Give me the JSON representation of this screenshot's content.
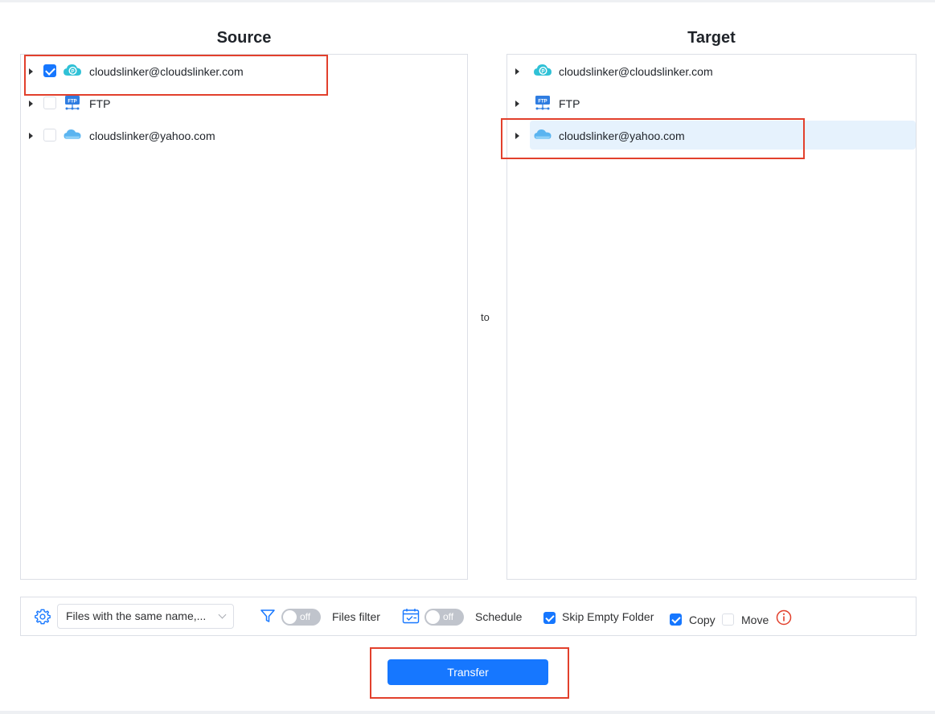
{
  "source": {
    "title": "Source",
    "items": [
      {
        "label": "cloudslinker@cloudslinker.com",
        "checked": true,
        "icon": "pcloud-icon"
      },
      {
        "label": "FTP",
        "checked": false,
        "icon": "ftp-icon"
      },
      {
        "label": "cloudslinker@yahoo.com",
        "checked": false,
        "icon": "cloud-icon"
      }
    ]
  },
  "target": {
    "title": "Target",
    "items": [
      {
        "label": "cloudslinker@cloudslinker.com",
        "icon": "pcloud-icon"
      },
      {
        "label": "FTP",
        "icon": "ftp-icon"
      },
      {
        "label": "cloudslinker@yahoo.com",
        "icon": "cloud-icon",
        "selected": true
      }
    ]
  },
  "to_label": "to",
  "options": {
    "conflict_select": "Files with the same name,...",
    "files_filter": {
      "label": "Files filter",
      "toggle": "off"
    },
    "schedule": {
      "label": "Schedule",
      "toggle": "off"
    },
    "skip_empty_folder": {
      "label": "Skip Empty Folder",
      "checked": true
    },
    "copy": {
      "label": "Copy",
      "checked": true
    },
    "move": {
      "label": "Move",
      "checked": false
    }
  },
  "transfer_button": "Transfer",
  "colors": {
    "accent": "#1677ff",
    "highlight": "#e2402c",
    "selected_row": "#e6f2fd"
  }
}
